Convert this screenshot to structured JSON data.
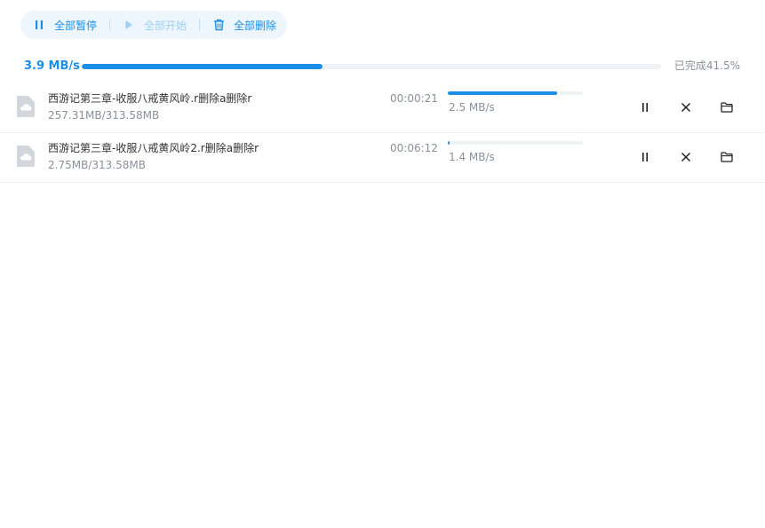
{
  "toolbar": {
    "pause_all": "全部暂停",
    "start_all": "全部开始",
    "delete_all": "全部删除"
  },
  "overall": {
    "speed": "3.9 MB/s",
    "progress": 0.415,
    "status_text": "已完成41.5%"
  },
  "tasks": [
    {
      "name": "西游记第三章-收服八戒黄风岭.r删除a删除r",
      "size": "257.31MB/313.58MB",
      "time_left": "00:00:21",
      "progress": 0.81,
      "speed": "2.5 MB/s"
    },
    {
      "name": "西游记第三章-收服八戒黄风岭2.r删除a删除r",
      "size": "2.75MB/313.58MB",
      "time_left": "00:06:12",
      "progress": 0.009,
      "speed": "1.4 MB/s"
    }
  ],
  "icons": {
    "file": "cloud-file-icon",
    "pause": "pause-icon",
    "cancel": "close-icon",
    "folder": "folder-icon"
  },
  "colors": {
    "accent": "#1b8fe6",
    "accent_disabled": "#9ccff3",
    "toolbar_bg": "#eef6fd",
    "track": "#f0f1f5",
    "muted_text": "#8a8f99"
  }
}
